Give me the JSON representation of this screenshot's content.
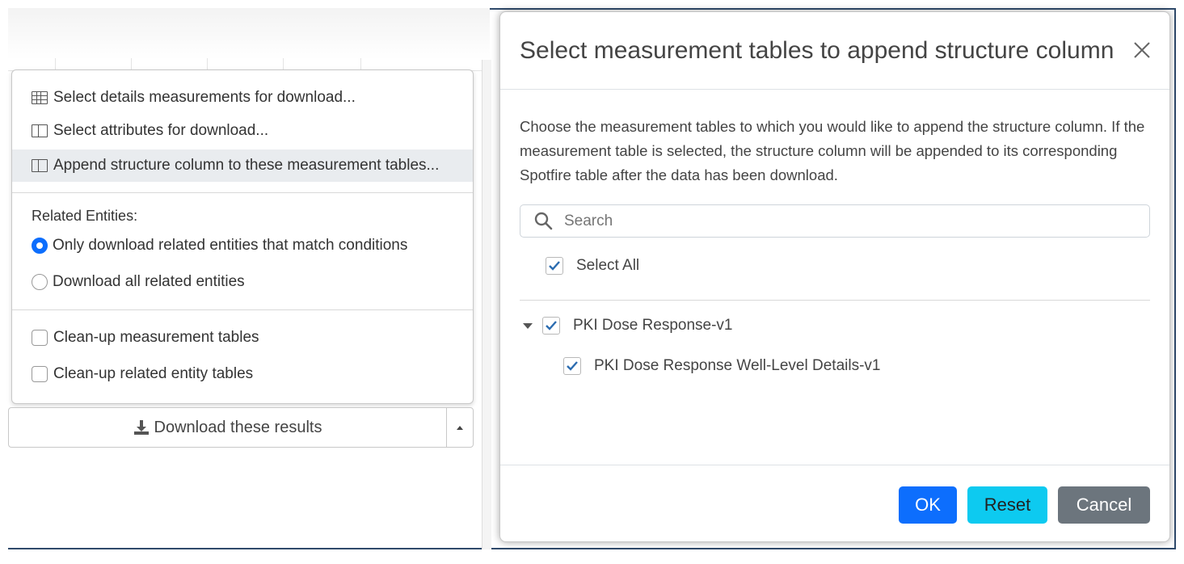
{
  "menu": {
    "items": [
      {
        "label": "Select details measurements for download...",
        "icon": "table-grid-icon"
      },
      {
        "label": "Select attributes for download...",
        "icon": "table-columns-icon"
      },
      {
        "label": "Append structure column to these measurement tables...",
        "icon": "table-columns-icon"
      }
    ],
    "related_label": "Related Entities:",
    "radios": [
      {
        "label": "Only download related entities that match conditions",
        "checked": true
      },
      {
        "label": "Download all related entities",
        "checked": false
      }
    ],
    "checkboxes": [
      {
        "label": "Clean-up measurement tables",
        "checked": false
      },
      {
        "label": "Clean-up related entity tables",
        "checked": false
      }
    ],
    "download_label": "Download these results"
  },
  "modal": {
    "title": "Select measurement tables to append structure column",
    "description": "Choose the measurement tables to which you would like to append the structure column. If the measurement table is selected, the structure column will be appended to its corresponding Spotfire table after the data has been download.",
    "search_placeholder": "Search",
    "select_all_label": "Select All",
    "tree": {
      "parent": "PKI Dose Response-v1",
      "child": "PKI Dose Response Well-Level Details-v1"
    },
    "buttons": {
      "ok": "OK",
      "reset": "Reset",
      "cancel": "Cancel"
    }
  },
  "colors": {
    "primary": "#0d6efd",
    "info": "#0dcaf0",
    "secondary": "#6c757d",
    "frame": "#2f4a6b"
  }
}
